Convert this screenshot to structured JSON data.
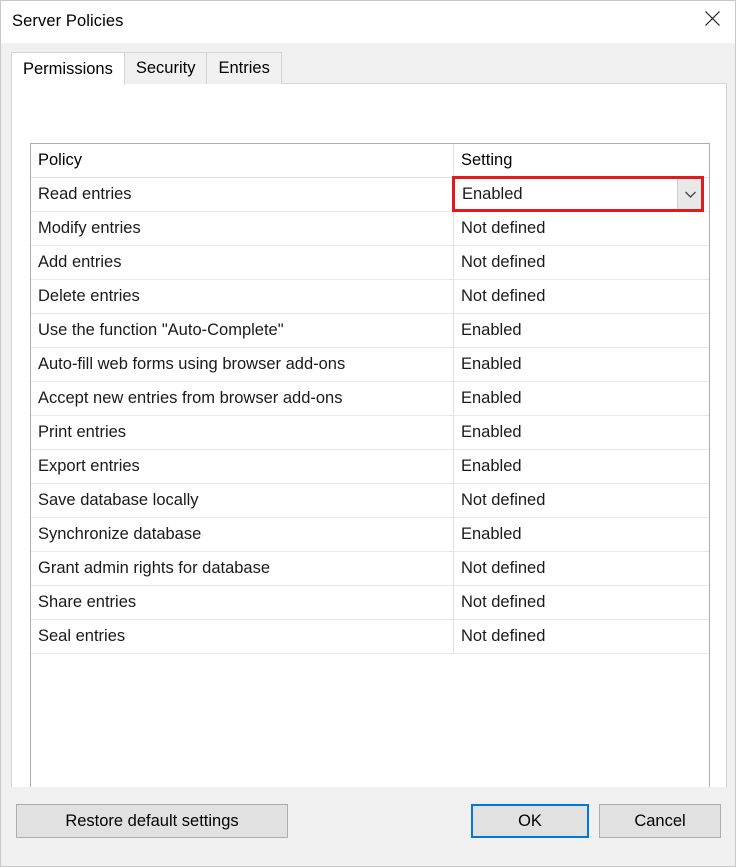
{
  "window": {
    "title": "Server Policies",
    "close_icon": "close-icon"
  },
  "tabs": [
    {
      "label": "Permissions",
      "selected": true
    },
    {
      "label": "Security",
      "selected": false
    },
    {
      "label": "Entries",
      "selected": false
    }
  ],
  "table": {
    "columns": [
      "Policy",
      "Setting"
    ],
    "rows": [
      {
        "policy": "Read entries",
        "setting": "Enabled",
        "editing": true,
        "highlighted": true
      },
      {
        "policy": "Modify entries",
        "setting": "Not defined",
        "editing": false,
        "highlighted": false
      },
      {
        "policy": "Add entries",
        "setting": "Not defined",
        "editing": false,
        "highlighted": false
      },
      {
        "policy": "Delete entries",
        "setting": "Not defined",
        "editing": false,
        "highlighted": false
      },
      {
        "policy": "Use the function \"Auto-Complete\"",
        "setting": "Enabled",
        "editing": false,
        "highlighted": false
      },
      {
        "policy": "Auto-fill web forms using browser add-ons",
        "setting": "Enabled",
        "editing": false,
        "highlighted": false
      },
      {
        "policy": "Accept new entries from browser add-ons",
        "setting": "Enabled",
        "editing": false,
        "highlighted": false
      },
      {
        "policy": "Print entries",
        "setting": "Enabled",
        "editing": false,
        "highlighted": false
      },
      {
        "policy": "Export entries",
        "setting": "Enabled",
        "editing": false,
        "highlighted": false
      },
      {
        "policy": "Save database locally",
        "setting": "Not defined",
        "editing": false,
        "highlighted": false
      },
      {
        "policy": "Synchronize database",
        "setting": "Enabled",
        "editing": false,
        "highlighted": false
      },
      {
        "policy": "Grant admin rights for database",
        "setting": "Not defined",
        "editing": false,
        "highlighted": false
      },
      {
        "policy": "Share entries",
        "setting": "Not defined",
        "editing": false,
        "highlighted": false
      },
      {
        "policy": "Seal entries",
        "setting": "Not defined",
        "editing": false,
        "highlighted": false
      }
    ]
  },
  "dropdown": {
    "selected_value": "Enabled",
    "arrow_icon": "chevron-down-icon"
  },
  "footer": {
    "restore_label": "Restore default settings",
    "ok_label": "OK",
    "cancel_label": "Cancel"
  },
  "colors": {
    "highlight": "#e01b1b",
    "focus": "#0078d7",
    "window_bg": "#f0f0f0",
    "panel_bg": "#ffffff"
  }
}
